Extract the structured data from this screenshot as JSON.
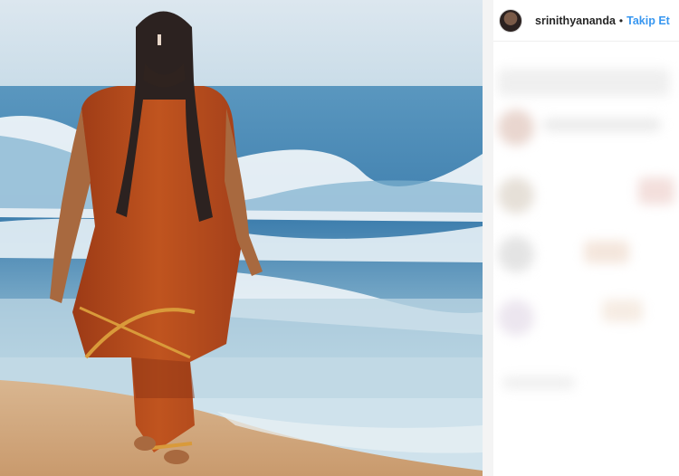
{
  "post": {
    "author": {
      "username": "srinithyananda",
      "avatar_icon": "profile-avatar",
      "follow_label": "Takip Et",
      "separator": "•"
    },
    "photo_subject": "man in saffron robes walking on beach",
    "comments_blurred": true
  },
  "colors": {
    "link": "#3897f0",
    "text": "#262626",
    "robe": "#b1461d"
  }
}
